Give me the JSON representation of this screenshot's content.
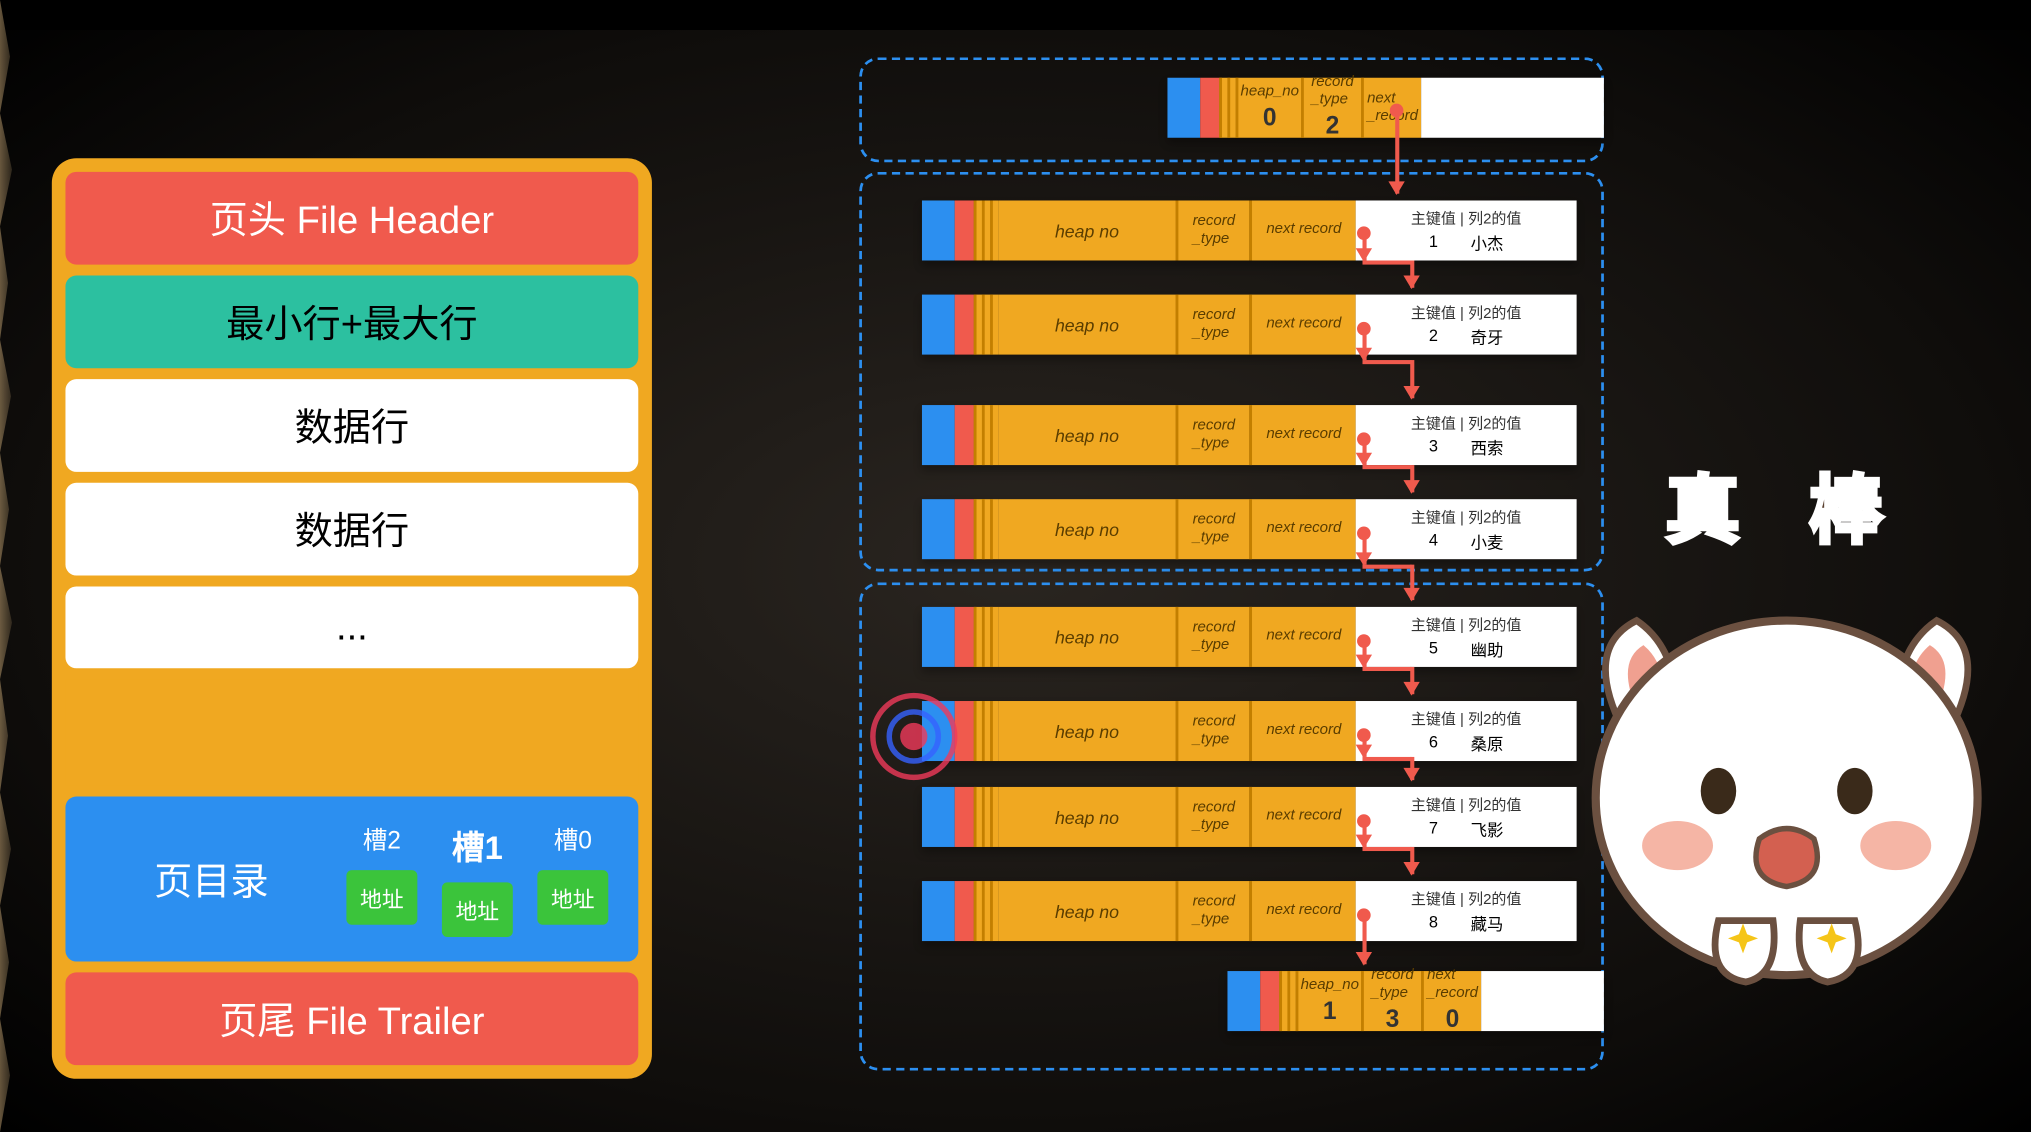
{
  "page_structure": {
    "header": "页头 File Header",
    "minmax": "最小行+最大行",
    "data_row": "数据行",
    "ellipsis": "...",
    "dir_label": "页目录",
    "slots": [
      {
        "name": "槽2",
        "addr": "地址",
        "big": false
      },
      {
        "name": "槽1",
        "addr": "地址",
        "big": true
      },
      {
        "name": "槽0",
        "addr": "地址",
        "big": false
      }
    ],
    "trailer": "页尾 File Trailer"
  },
  "field_labels": {
    "heap_no": "heap_no",
    "heap_no_sp": "heap no",
    "record_type": "record\n_type",
    "next_record": "next\n_record",
    "next_record_sp": "next record",
    "data_header": "主键值 | 列2的值"
  },
  "infimum": {
    "heap_no": "0",
    "record_type": "2"
  },
  "rows": [
    {
      "pk": "1",
      "c2": "小杰"
    },
    {
      "pk": "2",
      "c2": "奇牙"
    },
    {
      "pk": "3",
      "c2": "西索"
    },
    {
      "pk": "4",
      "c2": "小麦"
    },
    {
      "pk": "5",
      "c2": "幽助"
    },
    {
      "pk": "6",
      "c2": "桑原"
    },
    {
      "pk": "7",
      "c2": "飞影"
    },
    {
      "pk": "8",
      "c2": "藏马"
    }
  ],
  "supremum": {
    "heap_no": "1",
    "record_type": "3",
    "next_record": "0"
  },
  "sticker": {
    "text": "真 棒"
  }
}
